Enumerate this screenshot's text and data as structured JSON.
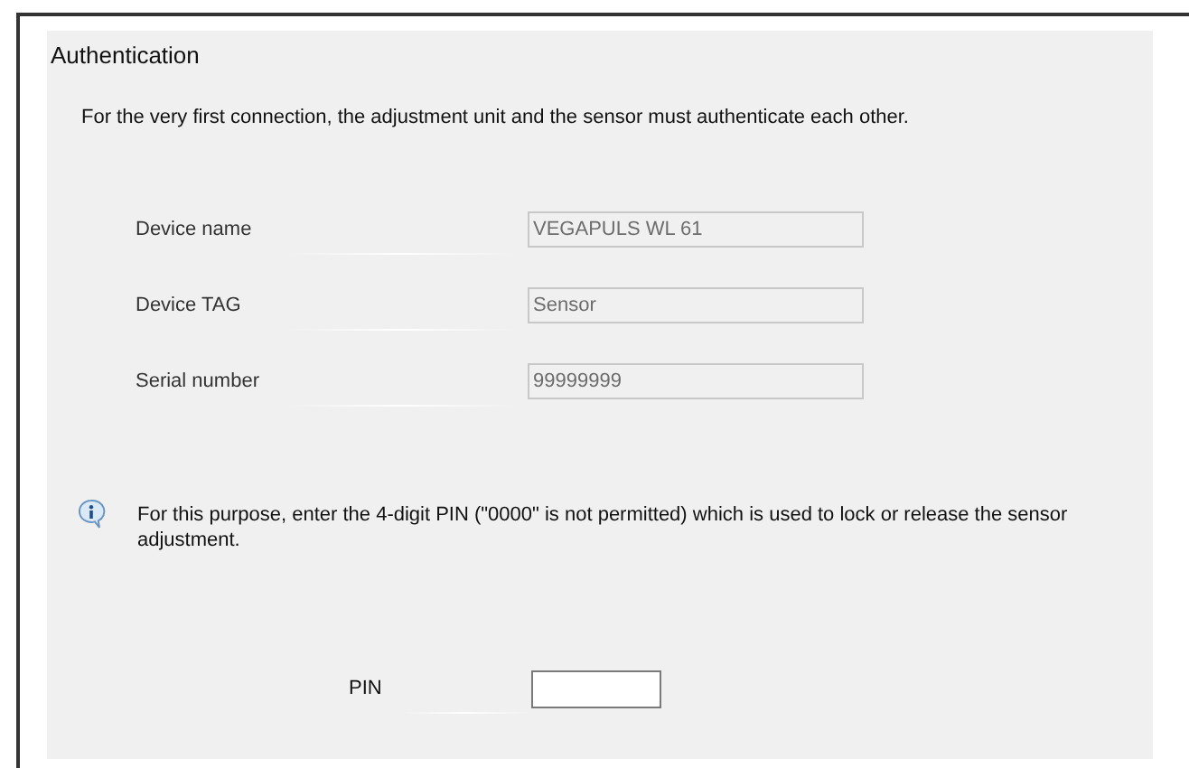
{
  "section_title": "Authentication",
  "intro": "For the very first connection, the adjustment unit and the sensor must authenticate each other.",
  "fields": [
    {
      "label": "Device name",
      "value": "VEGAPULS WL 61",
      "disabled": true
    },
    {
      "label": "Device TAG",
      "value": "Sensor",
      "disabled": true
    },
    {
      "label": "Serial number",
      "value": "99999999",
      "disabled": true
    }
  ],
  "info": "For this purpose, enter the 4-digit PIN (\"0000\" is not permitted) which is used to lock or release the sensor adjustment.",
  "pin": {
    "label": "PIN"
  }
}
